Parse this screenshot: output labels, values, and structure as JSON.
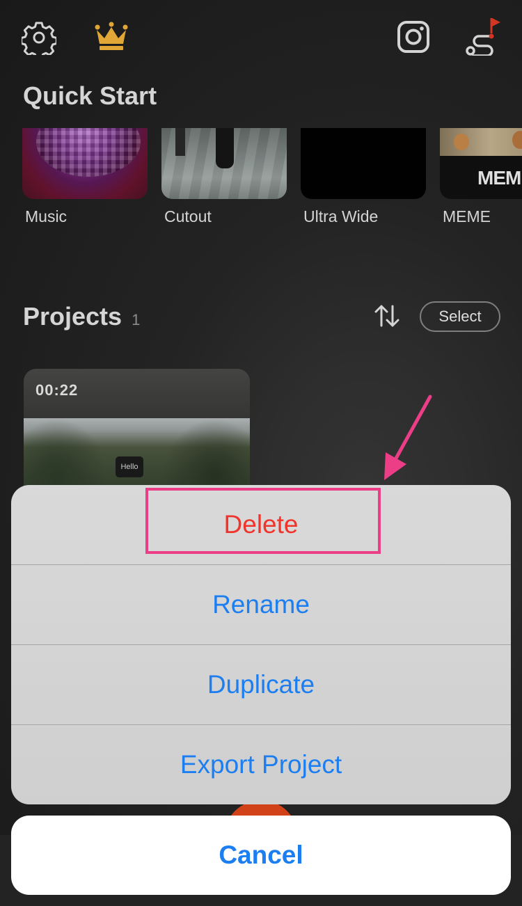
{
  "header": {
    "icons": [
      "gear-icon",
      "crown-icon",
      "instagram-icon",
      "tutorial-route-icon"
    ],
    "crown_color": "#f3b63b",
    "flag_color": "#e53b25"
  },
  "quick_start": {
    "title": "Quick Start",
    "items": [
      {
        "label": "Music"
      },
      {
        "label": "Cutout"
      },
      {
        "label": "Ultra Wide"
      },
      {
        "label": "MEME",
        "thumb_text": "MEME"
      }
    ]
  },
  "projects": {
    "title": "Projects",
    "count": "1",
    "select_label": "Select",
    "items": [
      {
        "duration": "00:22",
        "caption_tag": "Hello"
      }
    ]
  },
  "action_sheet": {
    "items": [
      {
        "label": "Delete",
        "style": "destructive"
      },
      {
        "label": "Rename"
      },
      {
        "label": "Duplicate"
      },
      {
        "label": "Export Project"
      }
    ],
    "cancel_label": "Cancel",
    "accent_color": "#1c7ef0",
    "destructive_color": "#f0342b"
  },
  "annotation": {
    "highlight_color": "#ec3d87",
    "target": "Delete"
  }
}
